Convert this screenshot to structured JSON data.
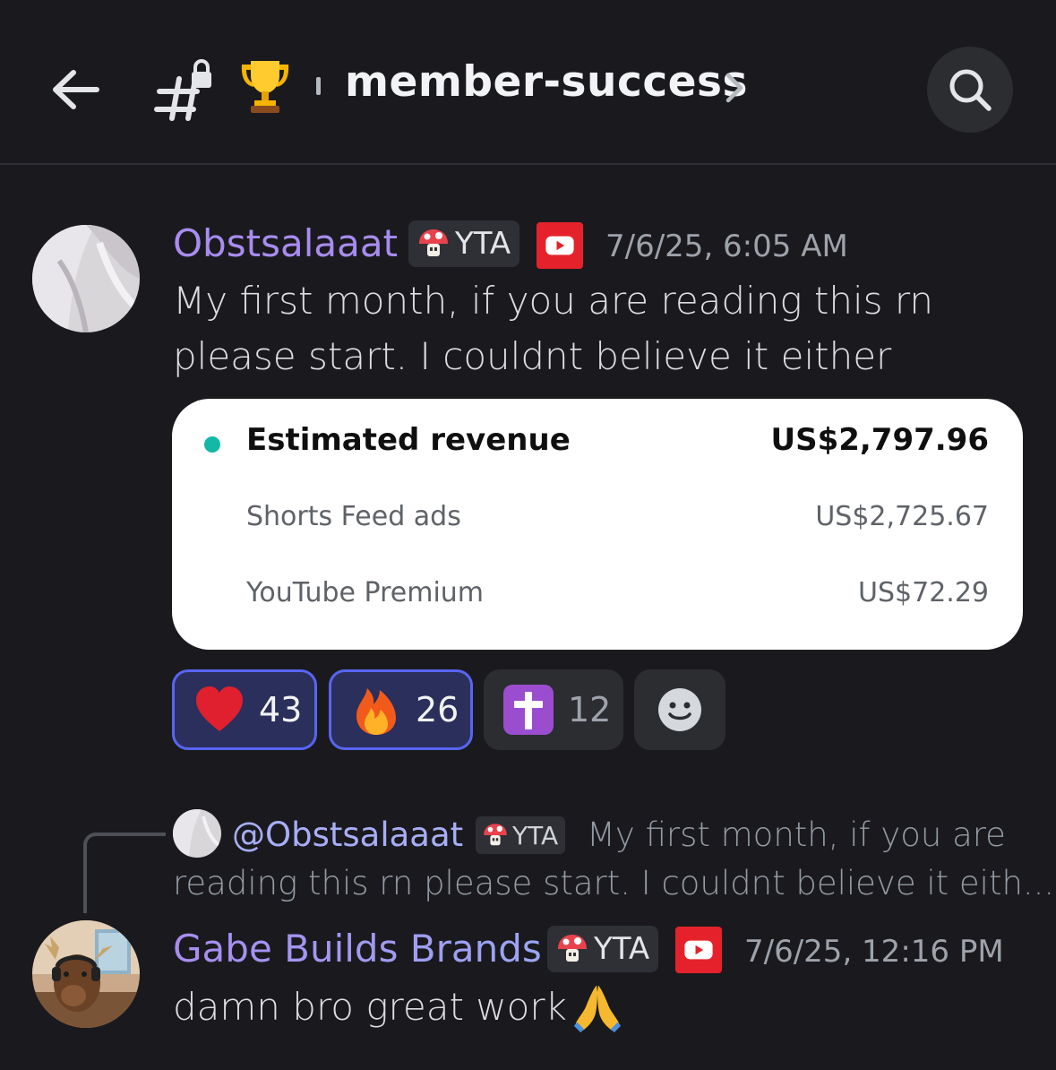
{
  "header": {
    "channel_name": "member-success",
    "back_icon": "arrow-left-icon",
    "channel_icon": "locked-hash-icon",
    "trophy_icon": "trophy-emoji-icon",
    "search_icon": "search-icon"
  },
  "messages": [
    {
      "username": "Obstsalaaat",
      "username_color": "#a88cf0",
      "tag": "YTA",
      "timestamp": "7/6/25, 6:05 AM",
      "text_line1": "My first month, if you are reading this rn",
      "text_line2": "please start. I couldnt believe it either",
      "revenue_card": {
        "title": "Estimated revenue",
        "total": "US$2,797.96",
        "rows": [
          {
            "label": "Shorts Feed ads",
            "value": "US$2,725.67"
          },
          {
            "label": "YouTube Premium",
            "value": "US$72.29"
          }
        ],
        "dot_color": "#14b8a6"
      },
      "reactions": [
        {
          "emoji": "heart",
          "count": "43",
          "active": true
        },
        {
          "emoji": "fire",
          "count": "26",
          "active": true
        },
        {
          "emoji": "latin-cross",
          "count": "12",
          "active": false
        }
      ]
    },
    {
      "reply": {
        "mention": "@Obstsalaaat",
        "tag": "YTA",
        "text_line1": "My first month, if you are",
        "text_line2": "reading this rn please start. I couldnt believe it eith..."
      },
      "username": "Gabe Builds Brands",
      "tag": "YTA",
      "timestamp": "7/6/25, 12:16 PM",
      "text": "damn bro great work"
    }
  ],
  "colors": {
    "background": "#1a1a1e",
    "active_reaction_border": "#5865f2",
    "youtube_red": "#e5222b"
  }
}
